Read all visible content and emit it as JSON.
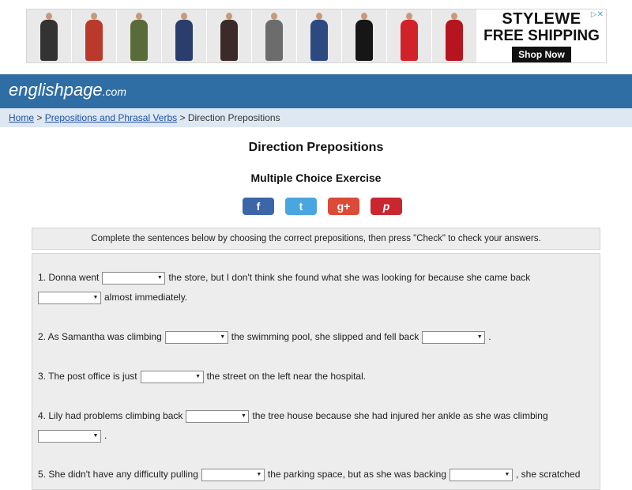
{
  "ad": {
    "brand": "STYLEWE",
    "offer": "FREE SHIPPING",
    "cta": "Shop Now",
    "close_icon": "close-ad-icon",
    "dresses": [
      {
        "color": "#333333"
      },
      {
        "color": "#b93a2c"
      },
      {
        "color": "#5a6b3a"
      },
      {
        "color": "#2b3e6b"
      },
      {
        "color": "#3b2a2a"
      },
      {
        "color": "#6c6c6c"
      },
      {
        "color": "#2c4a80"
      },
      {
        "color": "#161616"
      },
      {
        "color": "#d1222a"
      },
      {
        "color": "#b5151e"
      }
    ]
  },
  "site": {
    "logo_main": "englishpage",
    "logo_suffix": ".com",
    "brand_color": "#2f6ea4"
  },
  "breadcrumb": {
    "home": "Home",
    "sep1": " > ",
    "section": "Prepositions and Phrasal Verbs",
    "sep2": " > ",
    "current": "Direction Prepositions"
  },
  "page": {
    "title": "Direction Prepositions",
    "subtitle": "Multiple Choice Exercise"
  },
  "social": [
    {
      "label": "f",
      "icon": "facebook-icon",
      "color": "#3b66a8"
    },
    {
      "label": "t",
      "icon": "twitter-icon",
      "color": "#4aa6e0"
    },
    {
      "label": "g+",
      "icon": "google-plus-icon",
      "color": "#dc4a38"
    },
    {
      "label": "p",
      "icon": "pinterest-icon",
      "color": "#c9262f"
    }
  ],
  "instructions": "Complete the sentences below by choosing the correct prepositions, then press \"Check\" to check your answers.",
  "questions": {
    "q1": {
      "a": "1. Donna went",
      "b": "the store, but I don't think she found what she was looking for because she came back",
      "c": "almost immediately."
    },
    "q2": {
      "a": "2. As Samantha was climbing",
      "b": "the swimming pool, she slipped and fell back",
      "c": "."
    },
    "q3": {
      "a": "3. The post office is just",
      "b": "the street on the left near the hospital."
    },
    "q4": {
      "a": "4. Lily had problems climbing back",
      "b": "the tree house because she had injured her ankle as she was climbing",
      "c": "."
    },
    "q5": {
      "a": "5. She didn't have any difficulty pulling",
      "b": "the parking space, but as she was backing",
      "c": ", she scratched"
    }
  }
}
